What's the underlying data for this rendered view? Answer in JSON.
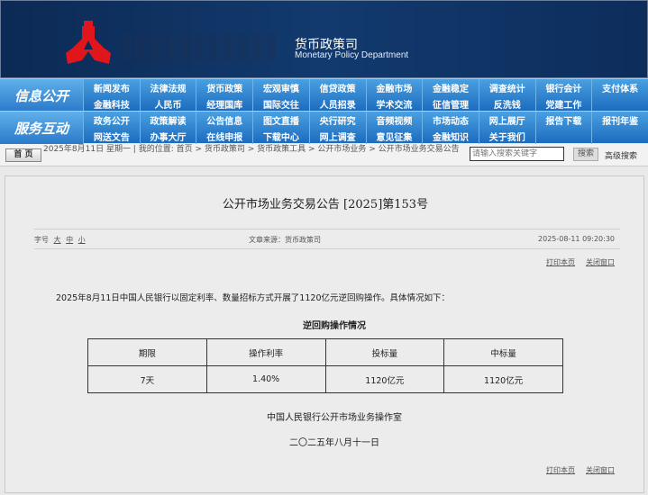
{
  "header": {
    "name_cn": "货币政策司",
    "name_en": "Monetary Policy Department"
  },
  "nav": [
    {
      "label": "信息公开",
      "items": [
        "新闻发布",
        "法律法规",
        "货币政策",
        "宏观审慎",
        "信贷政策",
        "金融市场",
        "金融稳定",
        "调查统计",
        "银行会计",
        "支付体系",
        "金融科技",
        "人民币",
        "经理国库",
        "国际交往",
        "人员招录",
        "学术交流",
        "征信管理",
        "反洗钱",
        "党建工作",
        ""
      ]
    },
    {
      "label": "服务互动",
      "items": [
        "政务公开",
        "政策解读",
        "公告信息",
        "图文直播",
        "央行研究",
        "音频视频",
        "市场动态",
        "网上展厅",
        "报告下载",
        "报刊年鉴",
        "网送文告",
        "办事大厅",
        "在线申报",
        "下载中心",
        "网上调查",
        "意见征集",
        "金融知识",
        "关于我们",
        "",
        ""
      ]
    }
  ],
  "breadcrumb": {
    "home": "首 页",
    "text": "2025年8月11日 星期一 | 我的位置: 首页 > 货币政策司 > 货币政策工具 > 公开市场业务 > 公开市场业务交易公告",
    "search_placeholder": "请输入搜索关键字",
    "search_btn": "搜索",
    "advanced": "高级搜索"
  },
  "article": {
    "title": "公开市场业务交易公告 [2025]第153号",
    "font_label": "字号",
    "font_sizes": [
      "大",
      "中",
      "小"
    ],
    "source": "文章来源：货币政策司",
    "datetime": "2025-08-11 09:20:30",
    "print": "打印本页",
    "close": "关闭窗口",
    "paragraph": "2025年8月11日中国人民银行以固定利率、数量招标方式开展了1120亿元逆回购操作。具体情况如下：",
    "table_caption": "逆回购操作情况",
    "table": {
      "headers": [
        "期限",
        "操作利率",
        "投标量",
        "中标量"
      ],
      "rows": [
        [
          "7天",
          "1.40%",
          "1120亿元",
          "1120亿元"
        ]
      ]
    },
    "signature": "中国人民银行公开市场业务操作室",
    "date": "二〇二五年八月十一日"
  }
}
